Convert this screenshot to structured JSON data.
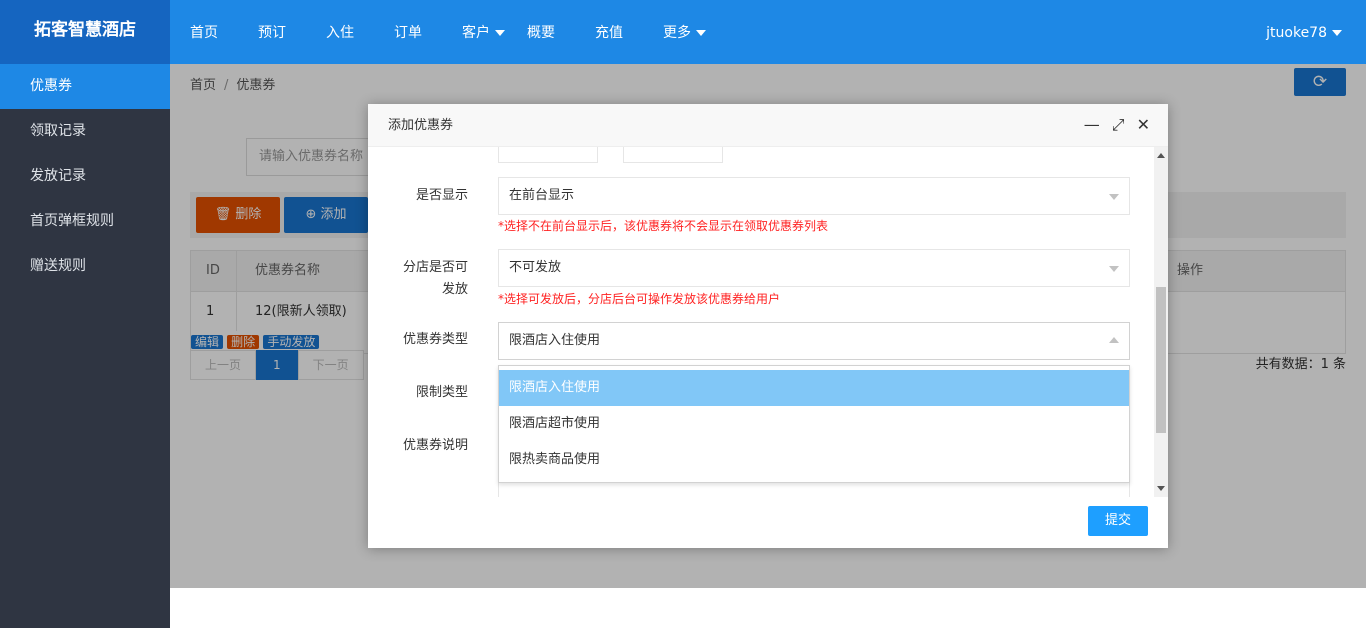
{
  "app": {
    "logo": "拓客智慧酒店",
    "user": "jtuoke78"
  },
  "topnav": [
    "首页",
    "预订",
    "入住",
    "订单",
    "客户",
    "概要",
    "充值",
    "更多"
  ],
  "sidebar": [
    "优惠券",
    "领取记录",
    "发放记录",
    "首页弹框规则",
    "赠送规则"
  ],
  "breadcrumb": {
    "home": "首页",
    "sep": "/",
    "current": "优惠券"
  },
  "search": {
    "placeholder": "请输入优惠券名称"
  },
  "toolbar": {
    "delete": "删除",
    "add": "添加"
  },
  "table": {
    "headers": {
      "id": "ID",
      "name": "优惠券名称",
      "ops": "操作"
    },
    "row": {
      "id": "1",
      "name": "12(限新人领取)"
    },
    "ops": {
      "edit": "编辑",
      "delete": "删除",
      "send": "手动发放"
    }
  },
  "pager": {
    "prev": "上一页",
    "page": "1",
    "next": "下一页",
    "total": "共有数据：1 条"
  },
  "modal": {
    "title": "添加优惠券",
    "show": {
      "label": "是否显示",
      "value": "在前台显示",
      "hint": "*选择不在前台显示后，该优惠券将不会显示在领取优惠券列表"
    },
    "branch": {
      "label_line1": "分店是否可",
      "label_line2": "发放",
      "value": "不可发放",
      "hint": "*选择可发放后，分店后台可操作发放该优惠券给用户"
    },
    "type": {
      "label": "优惠券类型",
      "value": "限酒店入住使用",
      "options": [
        "限酒店入住使用",
        "限酒店超市使用",
        "限热卖商品使用"
      ]
    },
    "limit": {
      "label": "限制类型"
    },
    "desc": {
      "label": "优惠券说明"
    },
    "submit": "提交"
  }
}
